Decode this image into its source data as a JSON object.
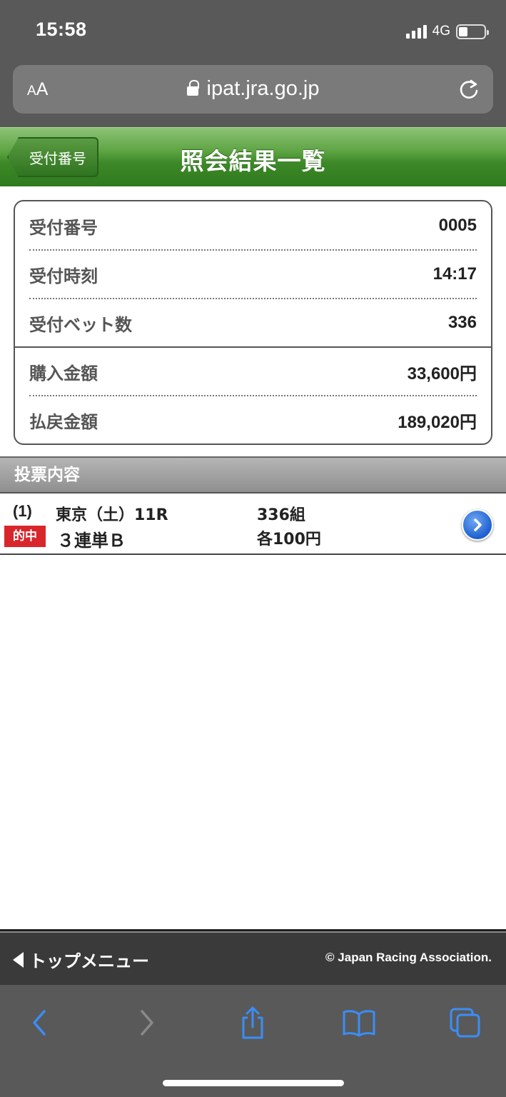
{
  "status_bar": {
    "time": "15:58",
    "network": "4G",
    "battery_level": 0.35
  },
  "browser": {
    "text_size_small": "A",
    "text_size_large": "A",
    "url": "ipat.jra.go.jp"
  },
  "header": {
    "back_label": "受付番号",
    "title": "照会結果一覧"
  },
  "summary": {
    "reception_number": {
      "label": "受付番号",
      "value": "0005"
    },
    "reception_time": {
      "label": "受付時刻",
      "value": "14:17"
    },
    "bet_count": {
      "label": "受付ベット数",
      "value": "336"
    },
    "purchase_amount": {
      "label": "購入金額",
      "value": "33,600円"
    },
    "payout_amount": {
      "label": "払戻金額",
      "value": "189,020円"
    }
  },
  "section": {
    "title": "投票内容"
  },
  "votes": [
    {
      "number": "(1)",
      "race": "東京（土）11R",
      "combinations": "336組",
      "badge": "的中",
      "bet_type": "３連単Ｂ",
      "amount": "各100円"
    }
  ],
  "footer": {
    "top_menu": "トップメニュー",
    "copyright": "© Japan Racing Association."
  },
  "colors": {
    "header_green": "#3d8828",
    "hit_red": "#d9262b",
    "toolbar_blue": "#3a8ef6"
  }
}
